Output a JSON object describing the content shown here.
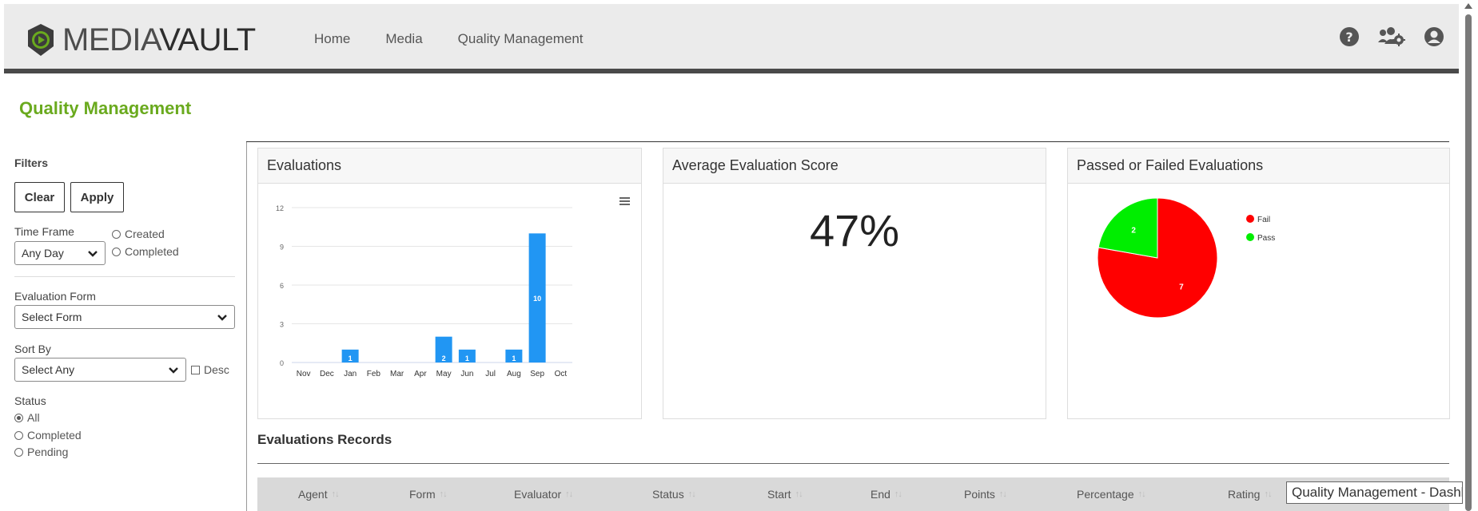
{
  "app": {
    "logo_light": "MEDIA",
    "logo_bold": "VAULT"
  },
  "nav": {
    "items": [
      "Home",
      "Media",
      "Quality Management"
    ]
  },
  "icons": {
    "help": "question-circle-icon",
    "users_settings": "users-gear-icon",
    "account": "user-circle-icon"
  },
  "page": {
    "title": "Quality Management"
  },
  "filters": {
    "heading": "Filters",
    "clear_label": "Clear",
    "apply_label": "Apply",
    "time_frame_label": "Time Frame",
    "time_frame_value": "Any Day",
    "date_radio_created": "Created",
    "date_radio_completed": "Completed",
    "evaluation_form_label": "Evaluation Form",
    "evaluation_form_value": "Select Form",
    "sort_by_label": "Sort By",
    "sort_by_value": "Select Any",
    "desc_label": "Desc",
    "status_label": "Status",
    "status_options": [
      "All",
      "Completed",
      "Pending"
    ],
    "status_selected": "All"
  },
  "panels": {
    "evaluations_title": "Evaluations",
    "avg_score_title": "Average Evaluation Score",
    "avg_score_value": "47%",
    "pass_fail_title": "Passed or Failed Evaluations"
  },
  "chart_data": [
    {
      "type": "bar",
      "categories": [
        "Nov",
        "Dec",
        "Jan",
        "Feb",
        "Mar",
        "Apr",
        "May",
        "Jun",
        "Jul",
        "Aug",
        "Sep",
        "Oct"
      ],
      "values": [
        0,
        0,
        1,
        0,
        0,
        0,
        2,
        1,
        0,
        1,
        10,
        0
      ],
      "yticks": [
        0,
        3,
        6,
        9,
        12
      ],
      "ylim": [
        0,
        12
      ],
      "color": "#2196f3",
      "grid": true
    },
    {
      "type": "pie",
      "labels": [
        "Fail",
        "Pass"
      ],
      "values": [
        7,
        2
      ],
      "colors": [
        "#ff0000",
        "#00ee00"
      ],
      "legend": "right"
    }
  ],
  "records": {
    "title": "Evaluations Records",
    "columns": [
      "Agent",
      "Form",
      "Evaluator",
      "Status",
      "Start",
      "End",
      "Points",
      "Percentage",
      "Rating"
    ]
  },
  "tooltip": {
    "text": "Quality Management - Dashboard"
  }
}
